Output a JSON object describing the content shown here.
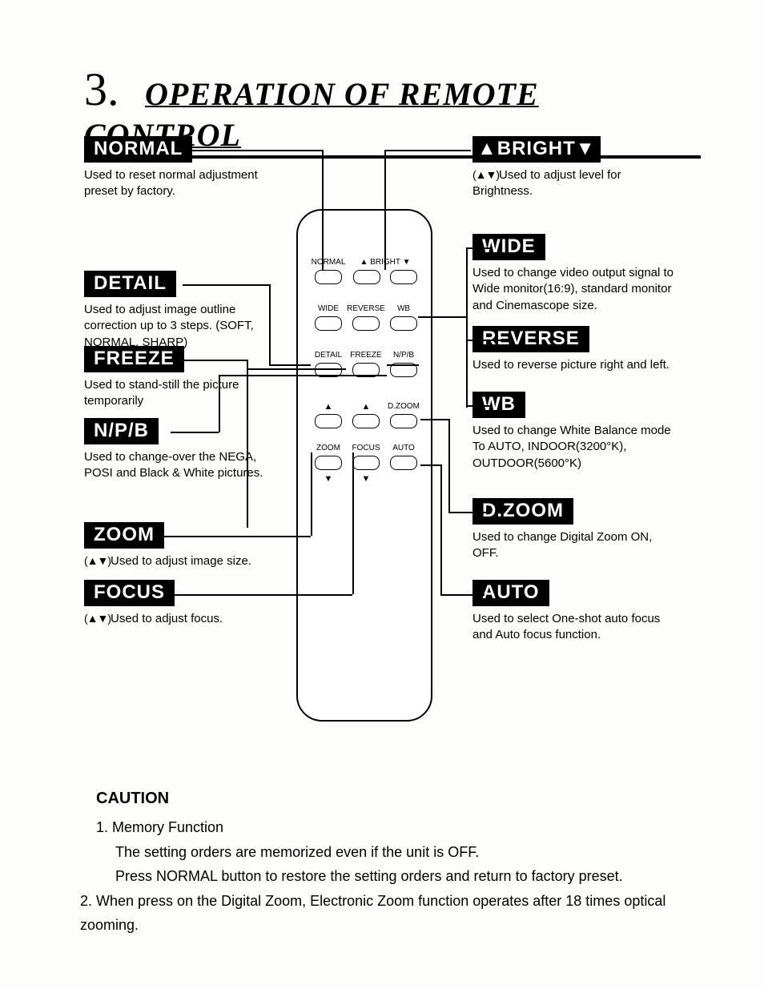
{
  "title": {
    "number": "3.",
    "text": "OPERATION OF REMOTE CONTROL"
  },
  "labels": {
    "normal": {
      "name": "NORMAL",
      "desc": "Used to reset normal adjustment preset by factory."
    },
    "detail": {
      "name": "DETAIL",
      "desc": "Used to adjust image outline correction up to 3 steps. (SOFT, NORMAL, SHARP)"
    },
    "freeze": {
      "name": "FREEZE",
      "desc": "Used to stand-still the picture temporarily"
    },
    "npb": {
      "name": "N/P/B",
      "desc": "Used to change-over the NEGA, POSI and Black & White pictures."
    },
    "zoom": {
      "name": "ZOOM",
      "desc": "Used to adjust image size."
    },
    "focus": {
      "name": "FOCUS",
      "desc": "Used to adjust focus."
    },
    "bright": {
      "name": "▲BRIGHT▼",
      "desc": "Used to adjust level for Brightness."
    },
    "wide": {
      "name": "WIDE",
      "desc": "Used to change video output signal to Wide monitor(16:9), standard monitor and Cinemascope size."
    },
    "reverse": {
      "name": "REVERSE",
      "desc": "Used to reverse picture right and left."
    },
    "wb": {
      "name": "WB",
      "desc": "Used to change White Balance mode To AUTO, INDOOR(3200°K), OUTDOOR(5600°K)"
    },
    "dzoom": {
      "name": "D.ZOOM",
      "desc": "Used to change Digital Zoom ON, OFF."
    },
    "auto": {
      "name": "AUTO",
      "desc": "Used to select One-shot auto focus and Auto focus function."
    },
    "udIcons": "(▲▼)"
  },
  "remote": {
    "row1": {
      "c1": "NORMAL",
      "c2": "▲ BRIGHT ▼",
      "c3": ""
    },
    "row2": {
      "c1": "WIDE",
      "c2": "REVERSE",
      "c3": "WB"
    },
    "row3": {
      "c1": "DETAIL",
      "c2": "FREEZE",
      "c3": "N/P/B"
    },
    "row4": {
      "c1": "▲",
      "c2": "▲",
      "c3": "D.ZOOM"
    },
    "row5": {
      "c1": "ZOOM",
      "c2": "FOCUS",
      "c3": "AUTO"
    },
    "row6": {
      "c1": "▼",
      "c2": "▼",
      "c3": ""
    }
  },
  "caution": {
    "heading": "CAUTION",
    "item1_title": "1.  Memory Function",
    "item1_l1": "The setting orders are memorized even if the unit is OFF.",
    "item1_l2": "Press NORMAL button to restore the setting orders and return to factory preset.",
    "item2": "2.  When press on the Digital Zoom, Electronic Zoom function operates after 18 times optical zooming."
  }
}
